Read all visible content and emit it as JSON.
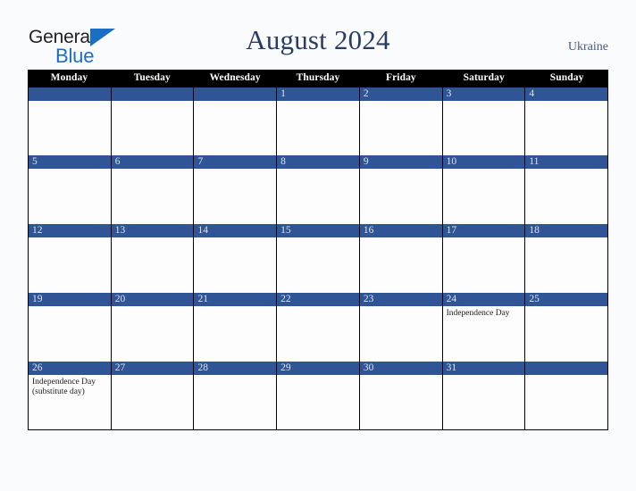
{
  "brand": {
    "name_top": "General",
    "name_bottom": "Blue",
    "triangle_color": "#1a6fc4"
  },
  "header": {
    "title": "August 2024",
    "country": "Ukraine"
  },
  "colors": {
    "page_background": "#fafbfc",
    "weekday_header_bg": "#000000",
    "weekday_header_text": "#ffffff",
    "day_bar_blue": "#2f5597",
    "day_number_text": "#dde2ec",
    "grid_line": "#000000",
    "title_text": "#2b3c63",
    "country_text": "#4a5a7c",
    "cell_background": "#fdfdfd"
  },
  "calendar": {
    "weekdays": [
      "Monday",
      "Tuesday",
      "Wednesday",
      "Thursday",
      "Friday",
      "Saturday",
      "Sunday"
    ],
    "weeks": [
      [
        {
          "day": "",
          "event": ""
        },
        {
          "day": "",
          "event": ""
        },
        {
          "day": "",
          "event": ""
        },
        {
          "day": "1",
          "event": ""
        },
        {
          "day": "2",
          "event": ""
        },
        {
          "day": "3",
          "event": ""
        },
        {
          "day": "4",
          "event": ""
        }
      ],
      [
        {
          "day": "5",
          "event": ""
        },
        {
          "day": "6",
          "event": ""
        },
        {
          "day": "7",
          "event": ""
        },
        {
          "day": "8",
          "event": ""
        },
        {
          "day": "9",
          "event": ""
        },
        {
          "day": "10",
          "event": ""
        },
        {
          "day": "11",
          "event": ""
        }
      ],
      [
        {
          "day": "12",
          "event": ""
        },
        {
          "day": "13",
          "event": ""
        },
        {
          "day": "14",
          "event": ""
        },
        {
          "day": "15",
          "event": ""
        },
        {
          "day": "16",
          "event": ""
        },
        {
          "day": "17",
          "event": ""
        },
        {
          "day": "18",
          "event": ""
        }
      ],
      [
        {
          "day": "19",
          "event": ""
        },
        {
          "day": "20",
          "event": ""
        },
        {
          "day": "21",
          "event": ""
        },
        {
          "day": "22",
          "event": ""
        },
        {
          "day": "23",
          "event": ""
        },
        {
          "day": "24",
          "event": "Independence Day"
        },
        {
          "day": "25",
          "event": ""
        }
      ],
      [
        {
          "day": "26",
          "event": "Independence Day\n(substitute day)"
        },
        {
          "day": "27",
          "event": ""
        },
        {
          "day": "28",
          "event": ""
        },
        {
          "day": "29",
          "event": ""
        },
        {
          "day": "30",
          "event": ""
        },
        {
          "day": "31",
          "event": ""
        },
        {
          "day": "",
          "event": ""
        }
      ]
    ]
  }
}
